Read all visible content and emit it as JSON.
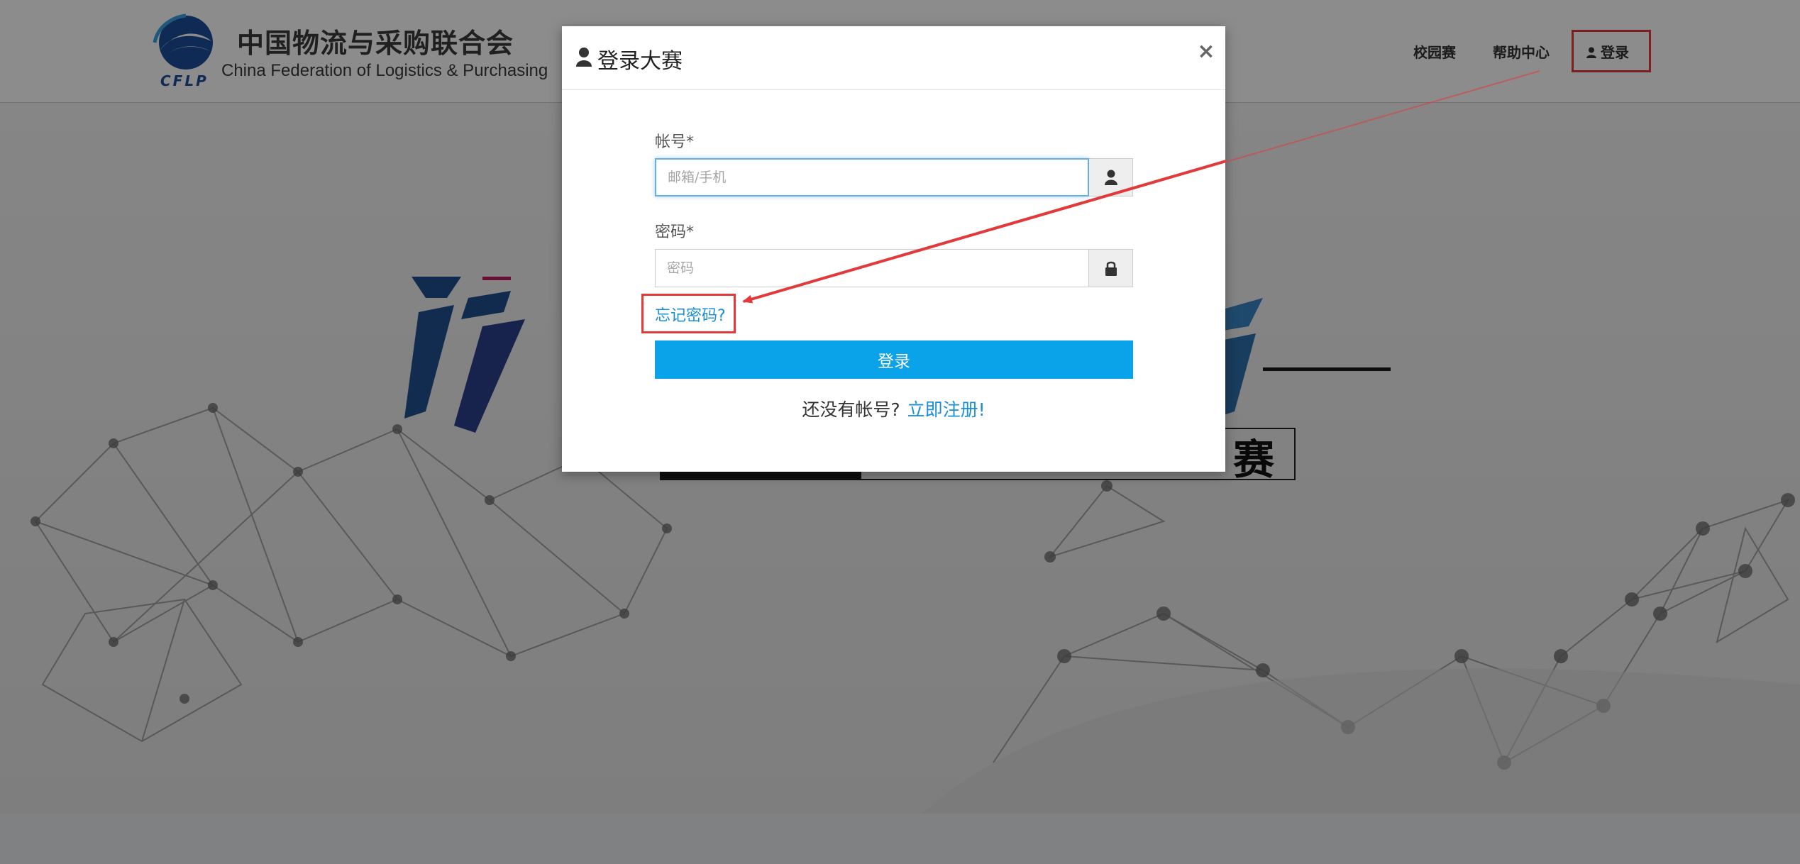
{
  "header": {
    "logo_cn": "中国物流与采购联合会",
    "logo_en": "China Federation of Logistics & Purchasing",
    "logo_mark_text": "CFLP"
  },
  "nav": {
    "items": [
      {
        "label": "校园赛"
      },
      {
        "label": "帮助中心"
      },
      {
        "label": "登录"
      }
    ]
  },
  "hero": {
    "subtitle_char": "赛"
  },
  "modal": {
    "title": "登录大赛",
    "close_symbol": "×",
    "account_label": "帐号*",
    "account_placeholder": "邮箱/手机",
    "password_label": "密码*",
    "password_placeholder": "密码",
    "forgot_password": "忘记密码?",
    "login_button": "登录",
    "no_account_text": "还没有帐号?",
    "register_link": "立即注册!"
  },
  "colors": {
    "accent": "#0aa2e8",
    "link": "#1a8fd8",
    "annotation_red": "#e23a3a"
  },
  "icons": {
    "title_icon": "user-icon",
    "account_addon_icon": "user-icon",
    "password_addon_icon": "lock-icon",
    "nav_login_icon": "user-icon"
  }
}
